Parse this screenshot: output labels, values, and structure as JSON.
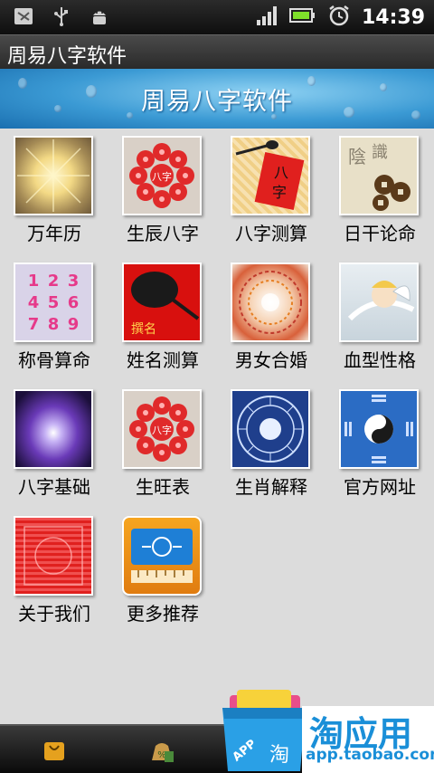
{
  "status_bar": {
    "icons": [
      "notification-icon",
      "usb-icon",
      "android-debug-icon"
    ],
    "right_icons": [
      "signal-icon",
      "battery-icon",
      "alarm-clock-icon"
    ],
    "time": "14:39"
  },
  "app": {
    "title": "周易八字软件",
    "banner_title": "周易八字软件"
  },
  "grid": {
    "items": [
      {
        "label": "万年历",
        "icon": "calendar-burst-icon"
      },
      {
        "label": "生辰八字",
        "icon": "bazi-flower-icon"
      },
      {
        "label": "八字测算",
        "icon": "brush-paper-icon"
      },
      {
        "label": "日干论命",
        "icon": "coins-calligraphy-icon"
      },
      {
        "label": "称骨算命",
        "icon": "numbers-grid-icon"
      },
      {
        "label": "姓名测算",
        "icon": "name-red-brush-icon"
      },
      {
        "label": "男女合婚",
        "icon": "zodiac-wheel-icon"
      },
      {
        "label": "血型性格",
        "icon": "cupid-icon"
      },
      {
        "label": "八字基础",
        "icon": "galaxy-icon"
      },
      {
        "label": "生旺表",
        "icon": "bazi-flower-icon"
      },
      {
        "label": "生肖解释",
        "icon": "zodiac-circle-icon"
      },
      {
        "label": "官方网址",
        "icon": "bagua-icon"
      },
      {
        "label": "关于我们",
        "icon": "red-pattern-icon"
      },
      {
        "label": "更多推荐",
        "icon": "ruler-app-icon"
      }
    ]
  },
  "bottom_bar": {
    "icons": [
      "shopping-bag-icon",
      "money-bag-icon"
    ]
  },
  "watermark": {
    "brand": "淘应用",
    "url": "app.taobao.com",
    "badge": "APP",
    "bag_char": "淘"
  },
  "colors": {
    "banner": "#3b9ad4",
    "grid_bg": "#dcdcdc",
    "flower_red": "#e02a2a",
    "watermark_blue": "#1a8fd8"
  }
}
